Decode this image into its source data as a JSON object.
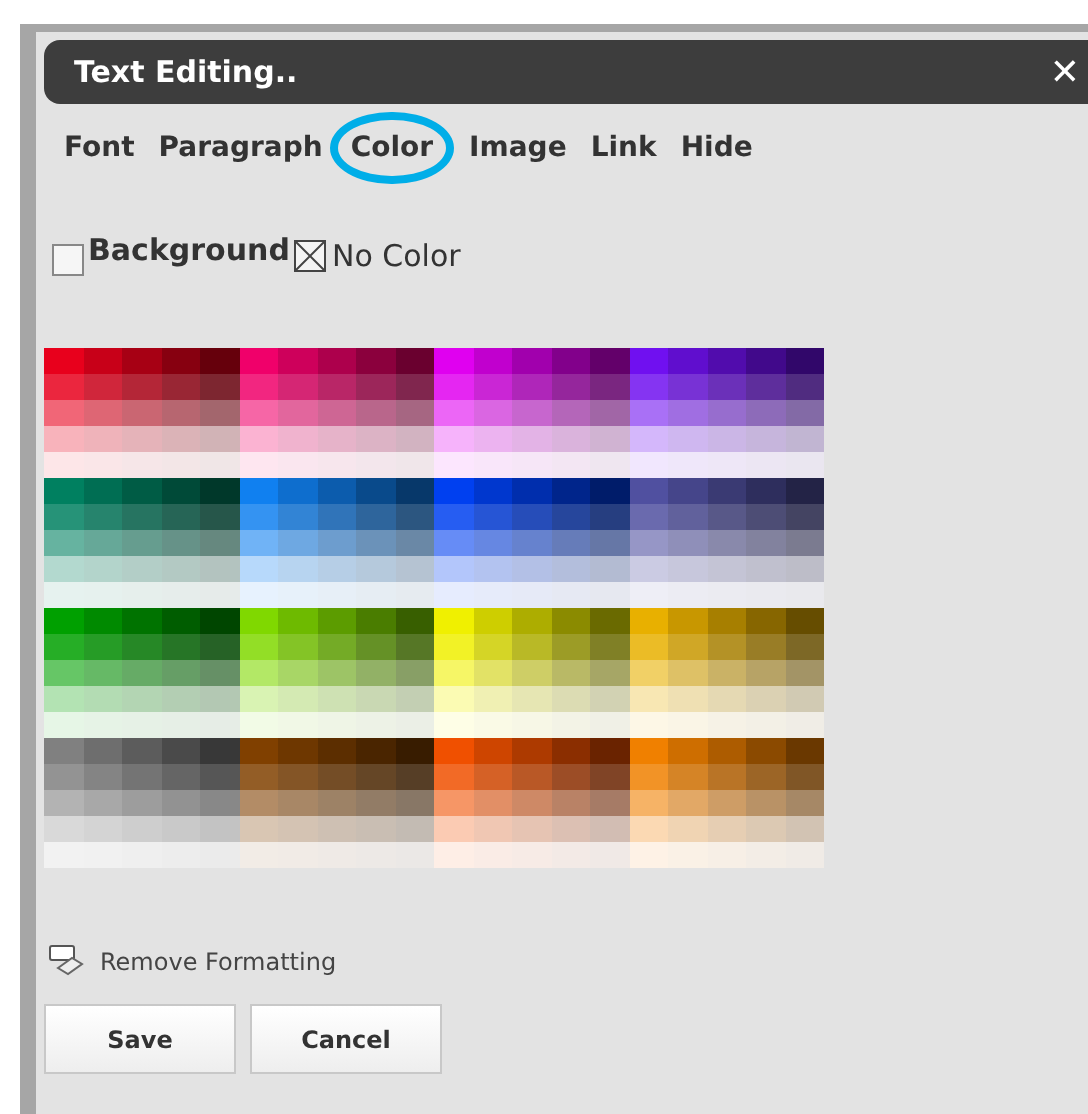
{
  "window": {
    "title": "Text Editing..",
    "close": "✕"
  },
  "tabs": [
    {
      "label": "Font",
      "selected": false
    },
    {
      "label": "Paragraph",
      "selected": false
    },
    {
      "label": "Color",
      "selected": true
    },
    {
      "label": "Image",
      "selected": false
    },
    {
      "label": "Link",
      "selected": false
    },
    {
      "label": "Hide",
      "selected": false
    }
  ],
  "background": {
    "label": "Background",
    "checked": false,
    "no_color": "No Color"
  },
  "palette": [
    {
      "color": "#e8001c"
    },
    {
      "color": "#f0006a"
    },
    {
      "color": "#e000f0"
    },
    {
      "color": "#7010f0"
    },
    {
      "color": "#008060"
    },
    {
      "color": "#1080f0"
    },
    {
      "color": "#0040f0"
    },
    {
      "color": "#5050a0"
    },
    {
      "color": "#00a000"
    },
    {
      "color": "#80d800"
    },
    {
      "color": "#f0f000"
    },
    {
      "color": "#e8b000"
    },
    {
      "color": "#808080"
    },
    {
      "color": "#804000"
    },
    {
      "color": "#f05000"
    },
    {
      "color": "#f08000"
    }
  ],
  "remove_formatting": "Remove Formatting",
  "buttons": [
    "Save",
    "Cancel"
  ]
}
